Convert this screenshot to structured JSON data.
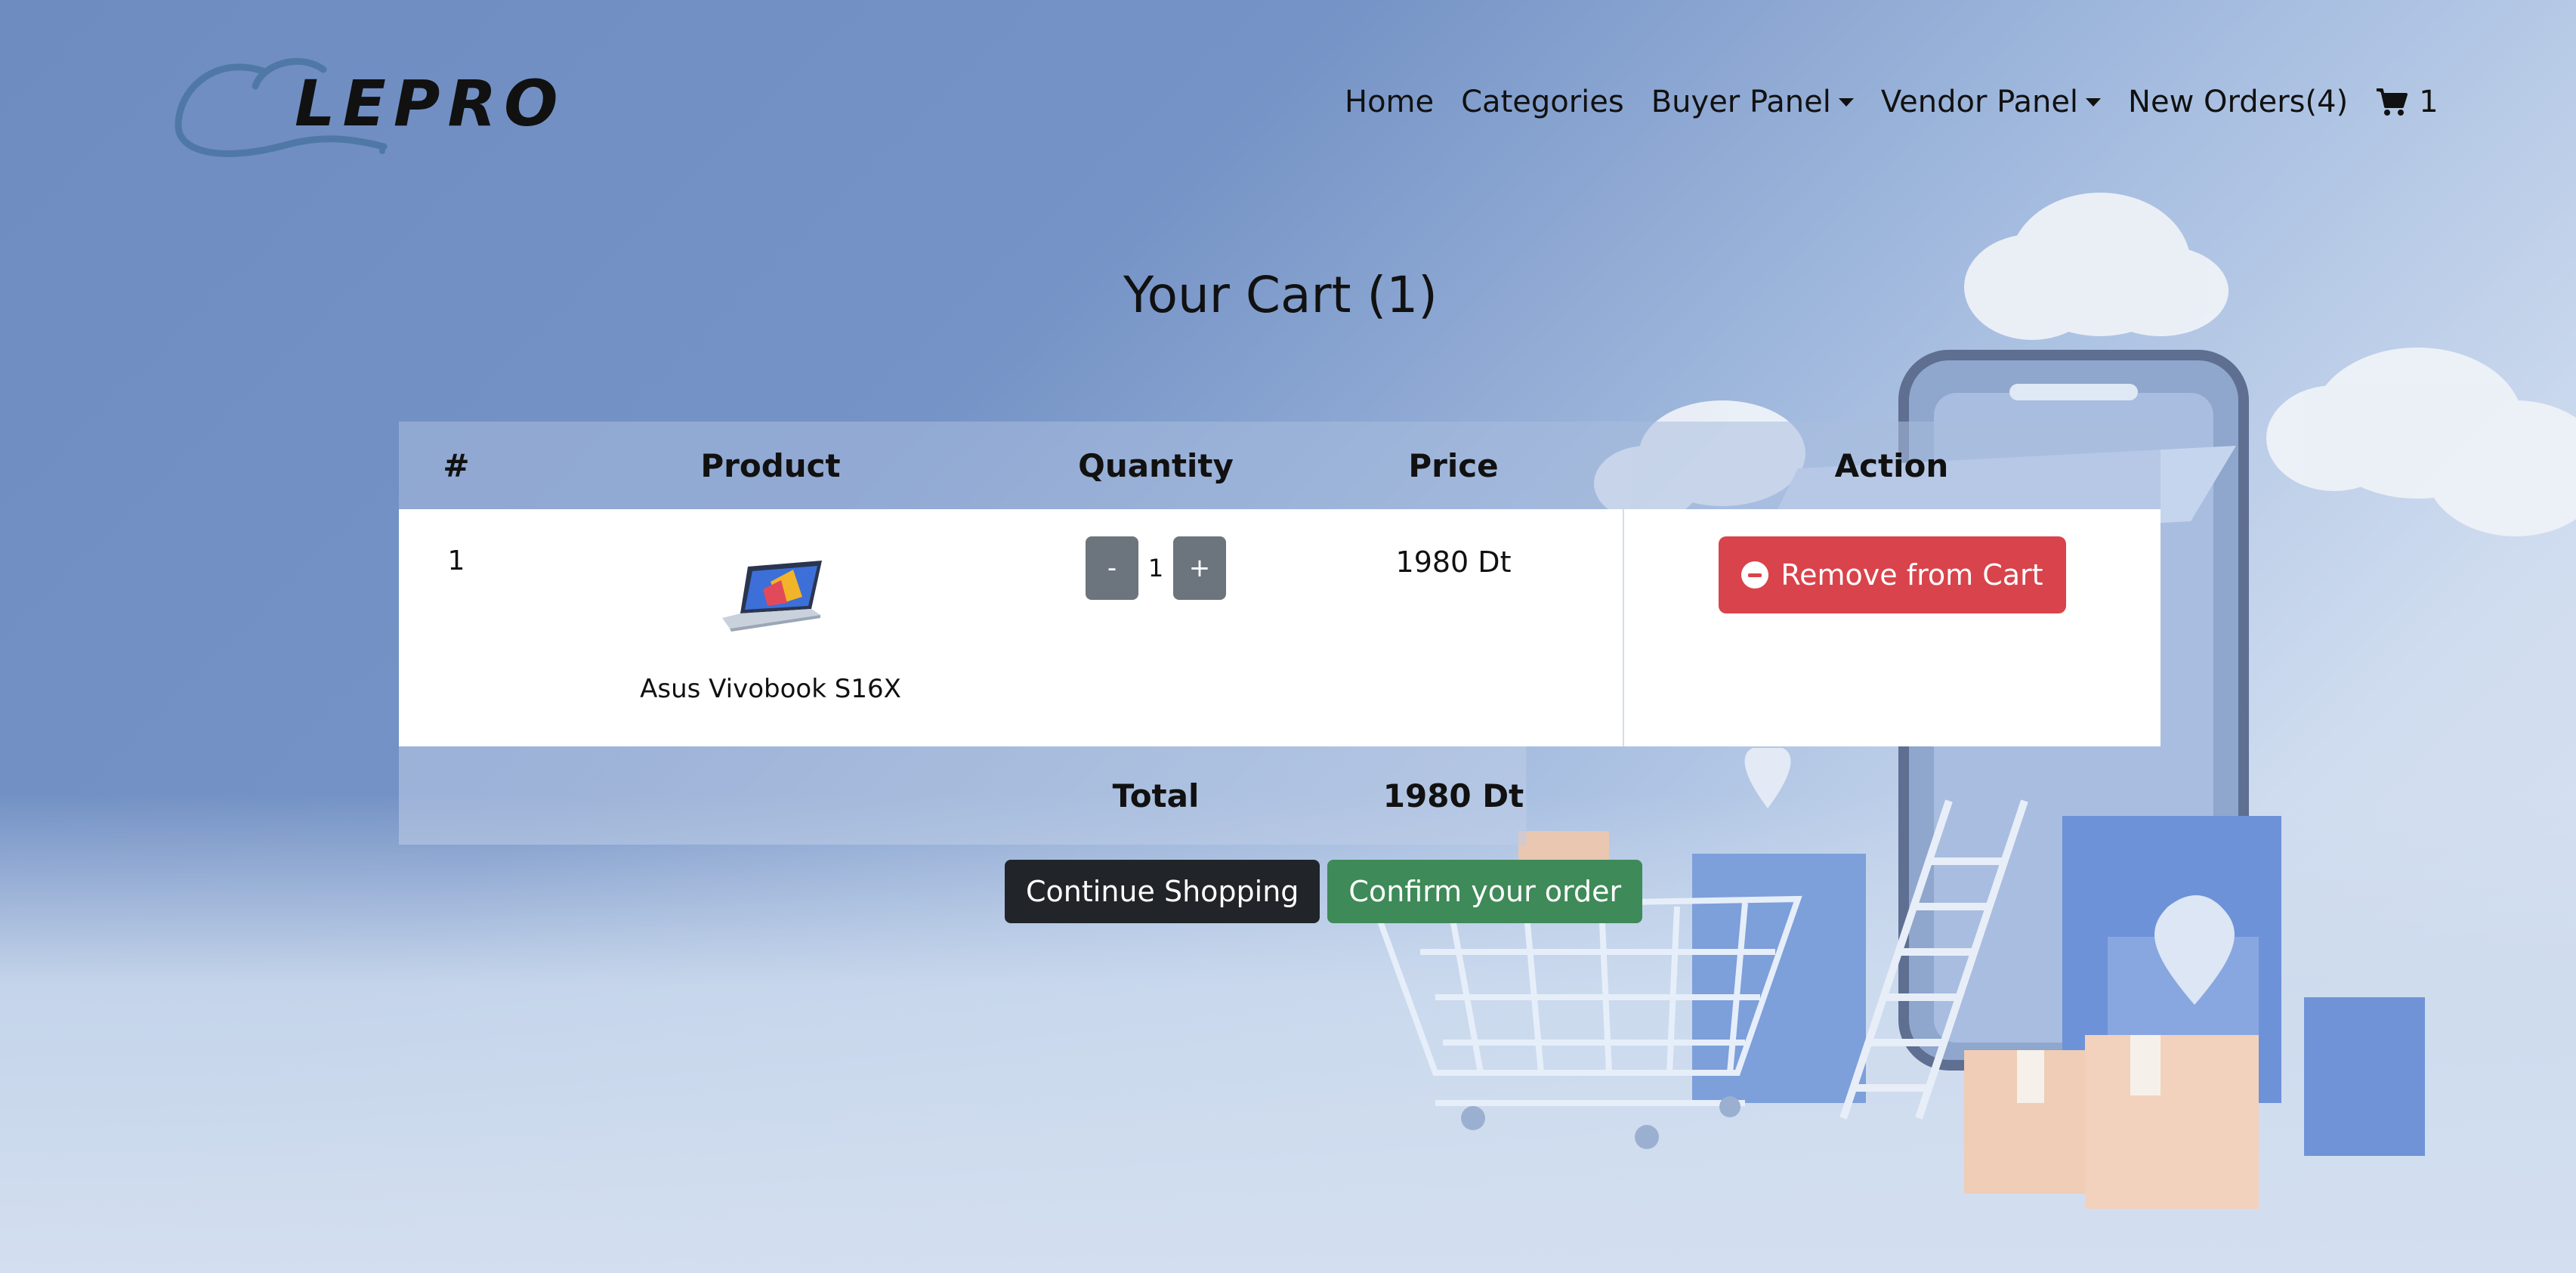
{
  "brand": {
    "logo_text": "LEPRO"
  },
  "nav": {
    "home": "Home",
    "categories": "Categories",
    "buyer_panel": "Buyer Panel",
    "vendor_panel": "Vendor Panel",
    "new_orders": "New Orders(4)",
    "cart_count": "1"
  },
  "page": {
    "title": "Your Cart (1)"
  },
  "table": {
    "headers": {
      "num": "#",
      "product": "Product",
      "quantity": "Quantity",
      "price": "Price",
      "action": "Action"
    },
    "rows": [
      {
        "num": "1",
        "product": "Asus Vivobook S16X",
        "quantity": "1",
        "price": "1980 Dt",
        "remove_label": "Remove from Cart",
        "minus": "-",
        "plus": "+"
      }
    ],
    "total_label": "Total",
    "total_value": "1980 Dt"
  },
  "buttons": {
    "continue": "Continue Shopping",
    "confirm": "Confirm your order"
  },
  "colors": {
    "danger": "#d9434b",
    "success": "#3e8a58",
    "dark": "#212529",
    "secondary": "#6c757d"
  }
}
